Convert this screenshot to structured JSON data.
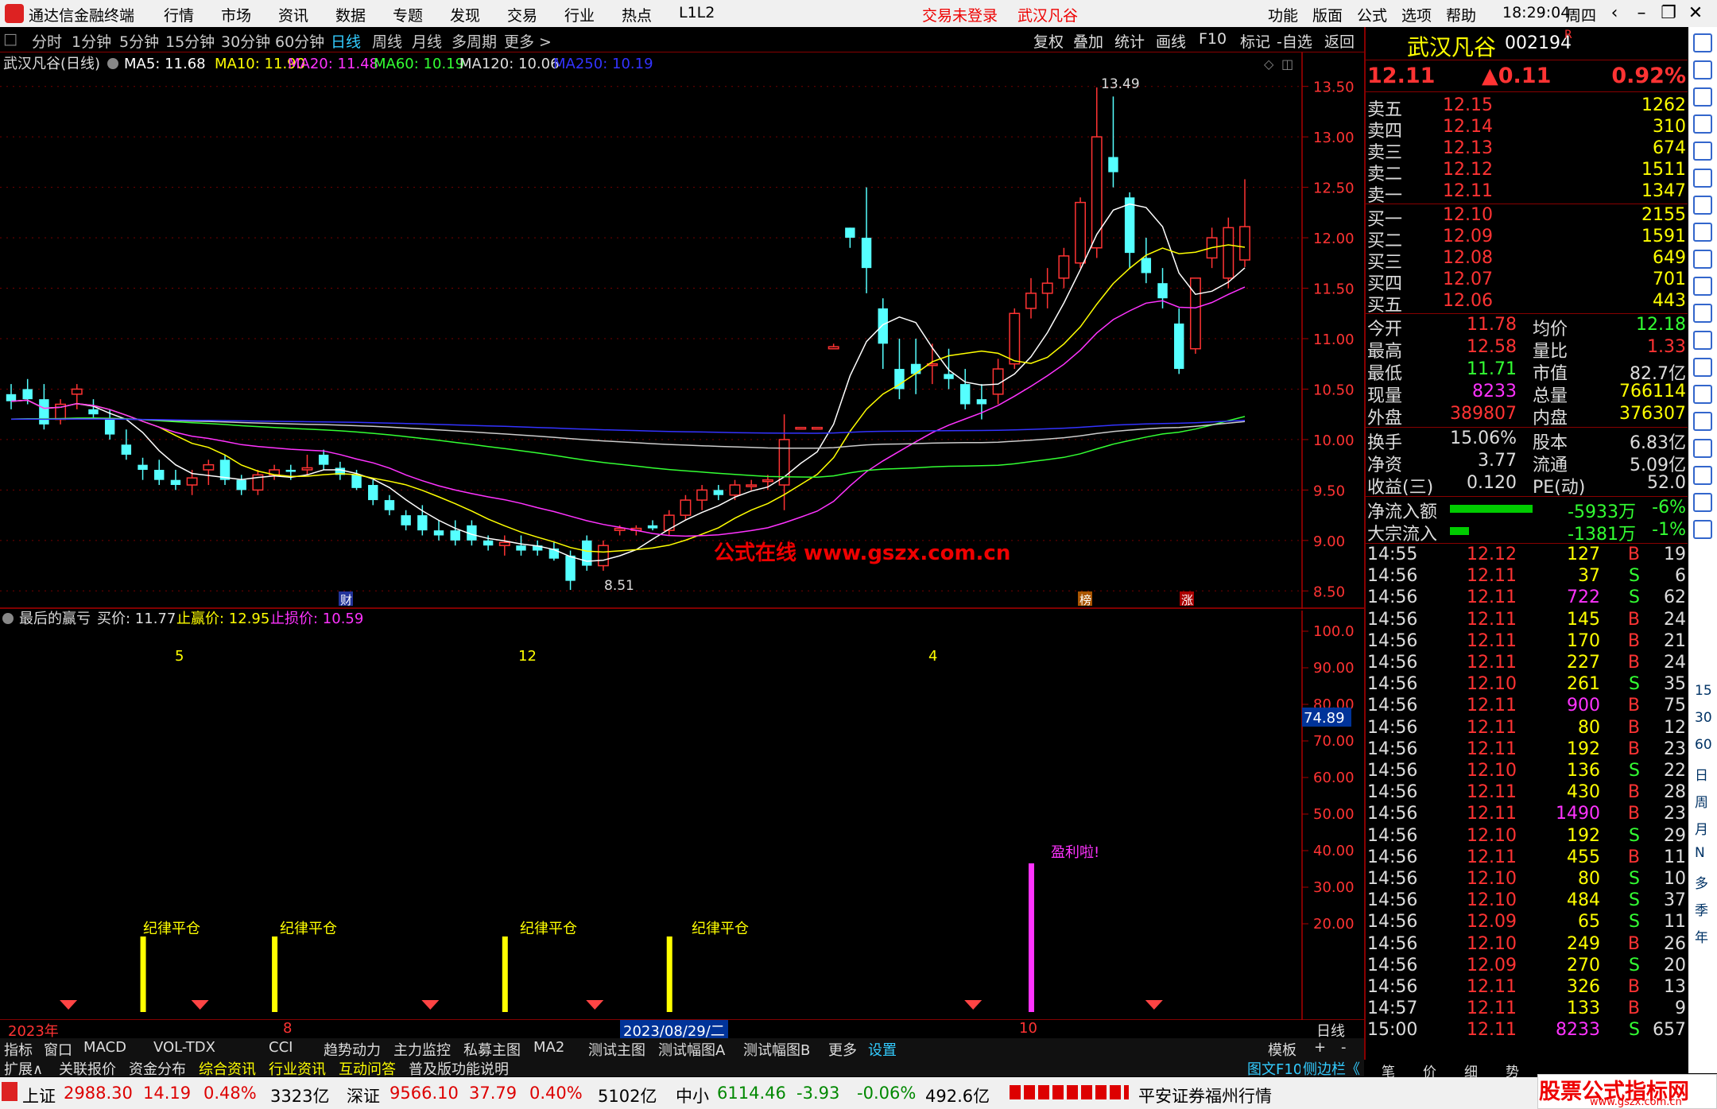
{
  "app": {
    "title": "通达信金融终端",
    "menu": [
      "行情",
      "市场",
      "资讯",
      "数据",
      "专题",
      "发现",
      "交易",
      "行业",
      "热点",
      "L1L2"
    ],
    "login": "交易未登录",
    "stock_title": "武汉凡谷",
    "right_menu": [
      "功能",
      "版面",
      "公式",
      "选项",
      "帮助"
    ],
    "time": "18:29:04",
    "weekday": "周四"
  },
  "timeframes": [
    "分时",
    "1分钟",
    "5分钟",
    "15分钟",
    "30分钟",
    "60分钟",
    "日线",
    "周线",
    "月线",
    "多周期",
    "更多 >"
  ],
  "active_tf": "日线",
  "chart_tools": [
    "复权",
    "叠加",
    "统计",
    "画线",
    "F10",
    "标记",
    "-自选",
    "返回"
  ],
  "ma_header": {
    "name": "武汉凡谷(日线)",
    "ma5": "MA5: 11.68",
    "ma10": "MA10: 11.90",
    "ma20": "MA20: 11.48",
    "ma60": "MA60: 10.19",
    "ma120": "MA120: 10.06",
    "ma250": "MA250: 10.19"
  },
  "price_axis": [
    "13.50",
    "13.00",
    "12.50",
    "12.00",
    "11.50",
    "11.00",
    "10.50",
    "10.00",
    "9.50",
    "9.00",
    "8.50"
  ],
  "annotations": {
    "high": "13.49",
    "low": "8.51",
    "watermark": "公式在线  www.gszx.com.cn",
    "marks": [
      "财",
      "榜",
      "涨"
    ]
  },
  "indicator": {
    "name": "最后的赢亏",
    "buy": "买价: 11.77",
    "profit": "止赢价: 12.95",
    "loss": "止损价: 10.59",
    "counts": [
      "5",
      "12",
      "4"
    ],
    "axis": [
      "100.0",
      "90.00",
      "80.00",
      "70.00",
      "60.00",
      "50.00",
      "40.00",
      "30.00",
      "20.00"
    ],
    "cursor": "74.89",
    "stop_label": "纪律平仓",
    "win_label": "盈利啦!"
  },
  "date_axis": {
    "year": "2023年",
    "m8": "8",
    "cursor_date": "2023/08/29/二",
    "m10": "10",
    "period": "日线"
  },
  "tabs1": [
    "指标",
    "窗口",
    "MACD",
    "VOL-TDX",
    "CCI",
    "趋势动力",
    "主力监控",
    "私募主图",
    "MA2",
    "测试主图",
    "测试幅图A",
    "测试幅图B",
    "更多",
    "设置"
  ],
  "tabs1_right": [
    "模板",
    "+",
    "-"
  ],
  "tabs2": [
    "扩展∧",
    "关联报价",
    "资金分布",
    "综合资讯",
    "行业资讯",
    "互动问答",
    "普及版功能说明"
  ],
  "quote": {
    "name": "武汉凡谷",
    "code": "002194",
    "price": "12.11",
    "change": "▲0.11",
    "pct": "0.92%",
    "sells": [
      [
        "卖五",
        "12.15",
        "1262"
      ],
      [
        "卖四",
        "12.14",
        "310"
      ],
      [
        "卖三",
        "12.13",
        "674"
      ],
      [
        "卖二",
        "12.12",
        "1511"
      ],
      [
        "卖一",
        "12.11",
        "1347"
      ]
    ],
    "buys": [
      [
        "买一",
        "12.10",
        "2155"
      ],
      [
        "买二",
        "12.09",
        "1591"
      ],
      [
        "买三",
        "12.08",
        "649"
      ],
      [
        "买四",
        "12.07",
        "701"
      ],
      [
        "买五",
        "12.06",
        "443"
      ]
    ],
    "stats": [
      [
        "今开",
        "11.78",
        "均价",
        "12.18"
      ],
      [
        "最高",
        "12.58",
        "量比",
        "1.33"
      ],
      [
        "最低",
        "11.71",
        "市值",
        "82.7亿"
      ],
      [
        "现量",
        "8233",
        "总量",
        "766114"
      ],
      [
        "外盘",
        "389807",
        "内盘",
        "376307"
      ]
    ],
    "stats2": [
      [
        "换手",
        "15.06%",
        "股本",
        "6.83亿"
      ],
      [
        "净资",
        "3.77",
        "流通",
        "5.09亿"
      ],
      [
        "收益(三)",
        "0.120",
        "PE(动)",
        "52.0"
      ]
    ],
    "flow": [
      [
        "净流入额",
        "-5933万",
        "-6%"
      ],
      [
        "大宗流入",
        "-1381万",
        "-1%"
      ]
    ],
    "ticks": [
      [
        "14:55",
        "12.12",
        "127",
        "B",
        "19"
      ],
      [
        "14:56",
        "12.11",
        "37",
        "S",
        "6"
      ],
      [
        "14:56",
        "12.11",
        "722",
        "S",
        "62"
      ],
      [
        "14:56",
        "12.11",
        "145",
        "B",
        "24"
      ],
      [
        "14:56",
        "12.11",
        "170",
        "B",
        "21"
      ],
      [
        "14:56",
        "12.11",
        "227",
        "B",
        "24"
      ],
      [
        "14:56",
        "12.10",
        "261",
        "S",
        "35"
      ],
      [
        "14:56",
        "12.11",
        "900",
        "B",
        "75"
      ],
      [
        "14:56",
        "12.11",
        "80",
        "B",
        "12"
      ],
      [
        "14:56",
        "12.11",
        "192",
        "B",
        "23"
      ],
      [
        "14:56",
        "12.10",
        "136",
        "S",
        "22"
      ],
      [
        "14:56",
        "12.11",
        "430",
        "B",
        "28"
      ],
      [
        "14:56",
        "12.11",
        "1490",
        "B",
        "23"
      ],
      [
        "14:56",
        "12.10",
        "192",
        "S",
        "29"
      ],
      [
        "14:56",
        "12.11",
        "455",
        "B",
        "11"
      ],
      [
        "14:56",
        "12.10",
        "80",
        "S",
        "10"
      ],
      [
        "14:56",
        "12.10",
        "484",
        "S",
        "37"
      ],
      [
        "14:56",
        "12.09",
        "65",
        "S",
        "11"
      ],
      [
        "14:56",
        "12.10",
        "249",
        "B",
        "26"
      ],
      [
        "14:56",
        "12.09",
        "270",
        "S",
        "20"
      ],
      [
        "14:56",
        "12.11",
        "326",
        "B",
        "13"
      ],
      [
        "14:57",
        "12.11",
        "133",
        "B",
        "9"
      ],
      [
        "15:00",
        "12.11",
        "8233",
        "S",
        "657"
      ]
    ],
    "tabs": [
      "笔",
      "价",
      "细",
      "势"
    ]
  },
  "sidebar_labels": [
    "15",
    "30",
    "60",
    "日",
    "周",
    "月",
    "N",
    "多",
    "季",
    "年"
  ],
  "status": {
    "sh_name": "上证",
    "sh": "2988.30",
    "sh_chg": "14.19",
    "sh_pct": "0.48%",
    "sh_amt": "3323亿",
    "sz_name": "深证",
    "sz": "9566.10",
    "sz_chg": "37.79",
    "sz_pct": "0.40%",
    "sz_amt": "5102亿",
    "zx_name": "中小",
    "zx": "6114.46",
    "zx_chg": "-3.93",
    "zx_pct": "-0.06%",
    "zx_amt": "492.6亿",
    "broker": "平安证券福州行情",
    "f10": "图文F10",
    "side": "侧边栏《",
    "banner": "股票公式指标网",
    "banner_url": "www.gszx.com.cn"
  },
  "chart_data": {
    "type": "candlestick",
    "note_ma": [
      "MA5",
      "MA10",
      "MA20",
      "MA60",
      "MA120",
      "MA250"
    ],
    "ylim": [
      8.4,
      13.6
    ],
    "ohlc": [
      [
        10.45,
        10.55,
        10.3,
        10.38
      ],
      [
        10.5,
        10.6,
        10.35,
        10.4
      ],
      [
        10.4,
        10.55,
        10.1,
        10.15
      ],
      [
        10.2,
        10.4,
        10.15,
        10.35
      ],
      [
        10.45,
        10.55,
        10.3,
        10.5
      ],
      [
        10.3,
        10.4,
        10.2,
        10.25
      ],
      [
        10.2,
        10.3,
        10.0,
        10.05
      ],
      [
        9.95,
        10.1,
        9.8,
        9.85
      ],
      [
        9.75,
        9.82,
        9.6,
        9.7
      ],
      [
        9.7,
        9.8,
        9.55,
        9.6
      ],
      [
        9.6,
        9.7,
        9.5,
        9.55
      ],
      [
        9.55,
        9.7,
        9.45,
        9.62
      ],
      [
        9.7,
        9.8,
        9.55,
        9.75
      ],
      [
        9.8,
        9.85,
        9.55,
        9.6
      ],
      [
        9.6,
        9.65,
        9.45,
        9.5
      ],
      [
        9.5,
        9.7,
        9.45,
        9.65
      ],
      [
        9.65,
        9.75,
        9.6,
        9.7
      ],
      [
        9.7,
        9.75,
        9.6,
        9.68
      ],
      [
        9.7,
        9.85,
        9.65,
        9.72
      ],
      [
        9.85,
        9.9,
        9.7,
        9.75
      ],
      [
        9.72,
        9.78,
        9.6,
        9.65
      ],
      [
        9.65,
        9.7,
        9.5,
        9.52
      ],
      [
        9.55,
        9.6,
        9.35,
        9.4
      ],
      [
        9.4,
        9.45,
        9.25,
        9.3
      ],
      [
        9.25,
        9.3,
        9.1,
        9.15
      ],
      [
        9.25,
        9.35,
        9.05,
        9.1
      ],
      [
        9.1,
        9.2,
        9.0,
        9.05
      ],
      [
        9.1,
        9.2,
        8.95,
        9.0
      ],
      [
        9.15,
        9.2,
        8.95,
        9.0
      ],
      [
        9.0,
        9.05,
        8.9,
        8.95
      ],
      [
        8.95,
        9.05,
        8.85,
        8.98
      ],
      [
        8.95,
        9.05,
        8.85,
        8.9
      ],
      [
        8.95,
        9.0,
        8.85,
        8.9
      ],
      [
        8.92,
        8.98,
        8.8,
        8.82
      ],
      [
        8.85,
        8.9,
        8.51,
        8.6
      ],
      [
        9.0,
        9.05,
        8.7,
        8.75
      ],
      [
        8.75,
        9.0,
        8.7,
        8.95
      ],
      [
        9.1,
        9.15,
        9.05,
        9.12
      ],
      [
        9.1,
        9.15,
        9.05,
        9.12
      ],
      [
        9.15,
        9.2,
        9.1,
        9.12
      ],
      [
        9.1,
        9.3,
        9.05,
        9.25
      ],
      [
        9.25,
        9.45,
        9.2,
        9.4
      ],
      [
        9.4,
        9.55,
        9.3,
        9.5
      ],
      [
        9.5,
        9.55,
        9.4,
        9.45
      ],
      [
        9.45,
        9.6,
        9.4,
        9.55
      ],
      [
        9.55,
        9.6,
        9.5,
        9.55
      ],
      [
        9.6,
        9.65,
        9.5,
        9.6
      ],
      [
        9.55,
        10.25,
        9.3,
        10.0
      ],
      [
        10.12,
        10.12,
        10.12,
        10.12
      ],
      [
        10.12,
        10.12,
        10.12,
        10.12
      ],
      [
        10.9,
        10.95,
        10.9,
        10.92
      ],
      [
        12.1,
        12.1,
        11.9,
        12.0
      ],
      [
        12.0,
        12.5,
        11.45,
        11.7
      ],
      [
        11.3,
        11.4,
        10.7,
        10.95
      ],
      [
        10.7,
        11.0,
        10.4,
        10.5
      ],
      [
        10.75,
        11.0,
        10.45,
        10.65
      ],
      [
        10.75,
        10.95,
        10.55,
        10.75
      ],
      [
        10.65,
        10.9,
        10.5,
        10.6
      ],
      [
        10.55,
        10.7,
        10.3,
        10.35
      ],
      [
        10.4,
        10.55,
        10.2,
        10.35
      ],
      [
        10.45,
        10.8,
        10.35,
        10.7
      ],
      [
        10.75,
        11.3,
        10.7,
        11.25
      ],
      [
        11.3,
        11.6,
        11.2,
        11.45
      ],
      [
        11.45,
        11.7,
        11.3,
        11.55
      ],
      [
        11.6,
        11.9,
        11.5,
        11.82
      ],
      [
        11.75,
        12.4,
        11.7,
        12.35
      ],
      [
        11.9,
        13.49,
        11.8,
        13.0
      ],
      [
        12.8,
        13.4,
        12.5,
        12.65
      ],
      [
        12.4,
        12.45,
        11.7,
        11.85
      ],
      [
        11.8,
        12.0,
        11.55,
        11.65
      ],
      [
        11.55,
        11.7,
        11.3,
        11.4
      ],
      [
        11.15,
        11.3,
        10.65,
        10.7
      ],
      [
        10.9,
        11.6,
        10.85,
        11.6
      ],
      [
        11.8,
        12.1,
        11.7,
        12.0
      ],
      [
        11.6,
        12.2,
        11.5,
        12.1
      ],
      [
        11.78,
        12.58,
        11.71,
        12.11
      ]
    ]
  }
}
